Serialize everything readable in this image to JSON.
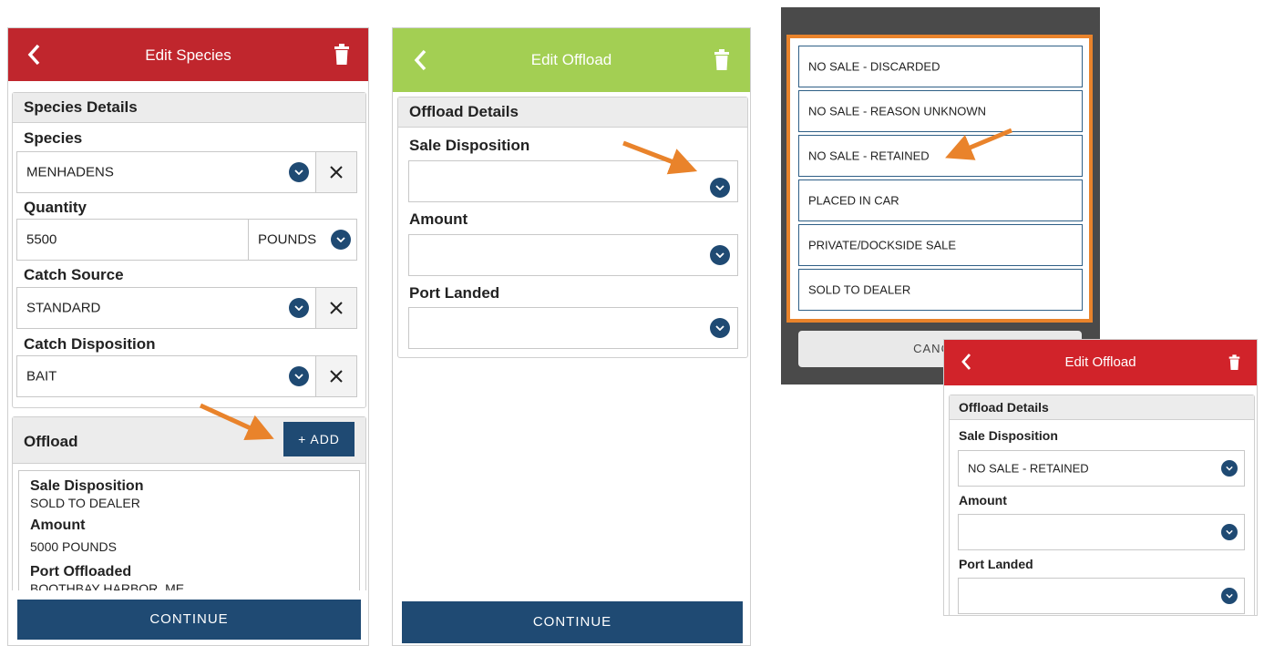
{
  "panel1": {
    "header": {
      "title": "Edit Species"
    },
    "species_card": {
      "heading": "Species Details",
      "species_label": "Species",
      "species_value": "MENHADENS",
      "quantity_label": "Quantity",
      "quantity_value": "5500",
      "quantity_unit": "POUNDS",
      "catch_source_label": "Catch Source",
      "catch_source_value": "STANDARD",
      "catch_disposition_label": "Catch Disposition",
      "catch_disposition_value": "BAIT"
    },
    "offload_card": {
      "heading": "Offload",
      "add_label": "+ ADD",
      "item": {
        "sale_label": "Sale Disposition",
        "sale_value": "SOLD TO DEALER",
        "amount_label": "Amount",
        "amount_value": "5000 POUNDS",
        "port_label": "Port Offloaded",
        "port_value": "BOOTHBAY HARBOR, ME"
      }
    },
    "continue_label": "CONTINUE"
  },
  "panel2": {
    "header": {
      "title": "Edit Offload"
    },
    "card": {
      "heading": "Offload Details",
      "sale_label": "Sale Disposition",
      "sale_value": "",
      "amount_label": "Amount",
      "amount_value": "",
      "port_label": "Port Landed",
      "port_value": ""
    },
    "continue_label": "CONTINUE"
  },
  "panel3": {
    "options": [
      "NO SALE - DISCARDED",
      "NO SALE - REASON UNKNOWN",
      "NO SALE - RETAINED",
      "PLACED IN CAR",
      "PRIVATE/DOCKSIDE SALE",
      "SOLD TO DEALER"
    ],
    "cancel_label": "CANCEL"
  },
  "panel4": {
    "header": {
      "title": "Edit Offload"
    },
    "card": {
      "heading": "Offload Details",
      "sale_label": "Sale Disposition",
      "sale_value": "NO SALE - RETAINED",
      "amount_label": "Amount",
      "amount_value": "",
      "port_label": "Port Landed",
      "port_value": ""
    }
  },
  "colors": {
    "red_header": "#c0262d",
    "green_header": "#a3cf53",
    "navy": "#1f4a73",
    "orange_arrow": "#e9832b",
    "overlay_gray": "#4a4a4a"
  },
  "icons": [
    "back-arrow-icon",
    "trash-icon",
    "chevron-down-icon",
    "close-icon",
    "arrow-pointer-icon"
  ]
}
